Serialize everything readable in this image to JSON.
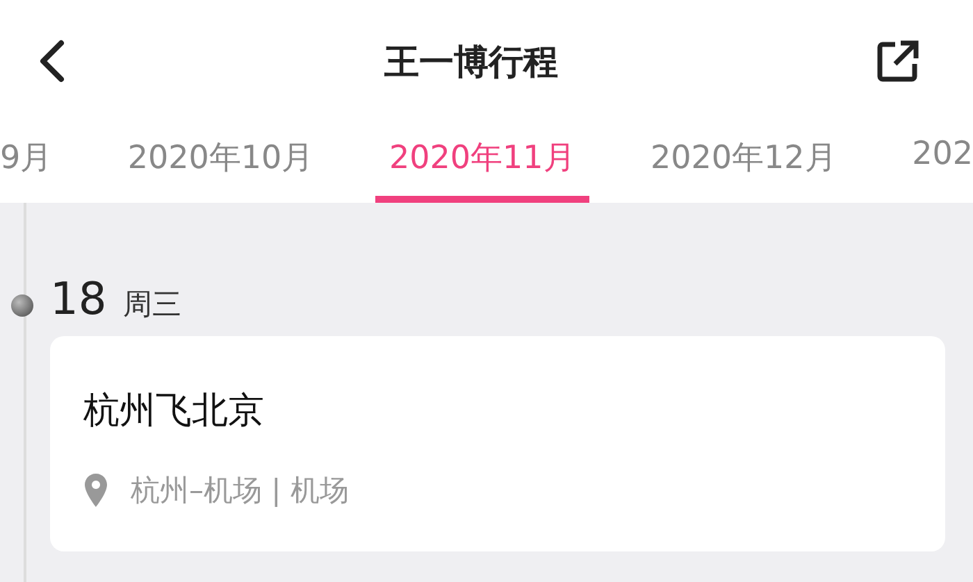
{
  "header": {
    "title": "王一博行程"
  },
  "tabs": [
    {
      "label": "9月",
      "selected": false
    },
    {
      "label": "2020年10月",
      "selected": false
    },
    {
      "label": "2020年11月",
      "selected": true
    },
    {
      "label": "2020年12月",
      "selected": false
    },
    {
      "label": "202",
      "selected": false
    }
  ],
  "days": [
    {
      "day": "18",
      "weekday": "周三",
      "events": [
        {
          "title": "杭州飞北京",
          "location": "杭州–机场 | 机场"
        }
      ]
    }
  ]
}
